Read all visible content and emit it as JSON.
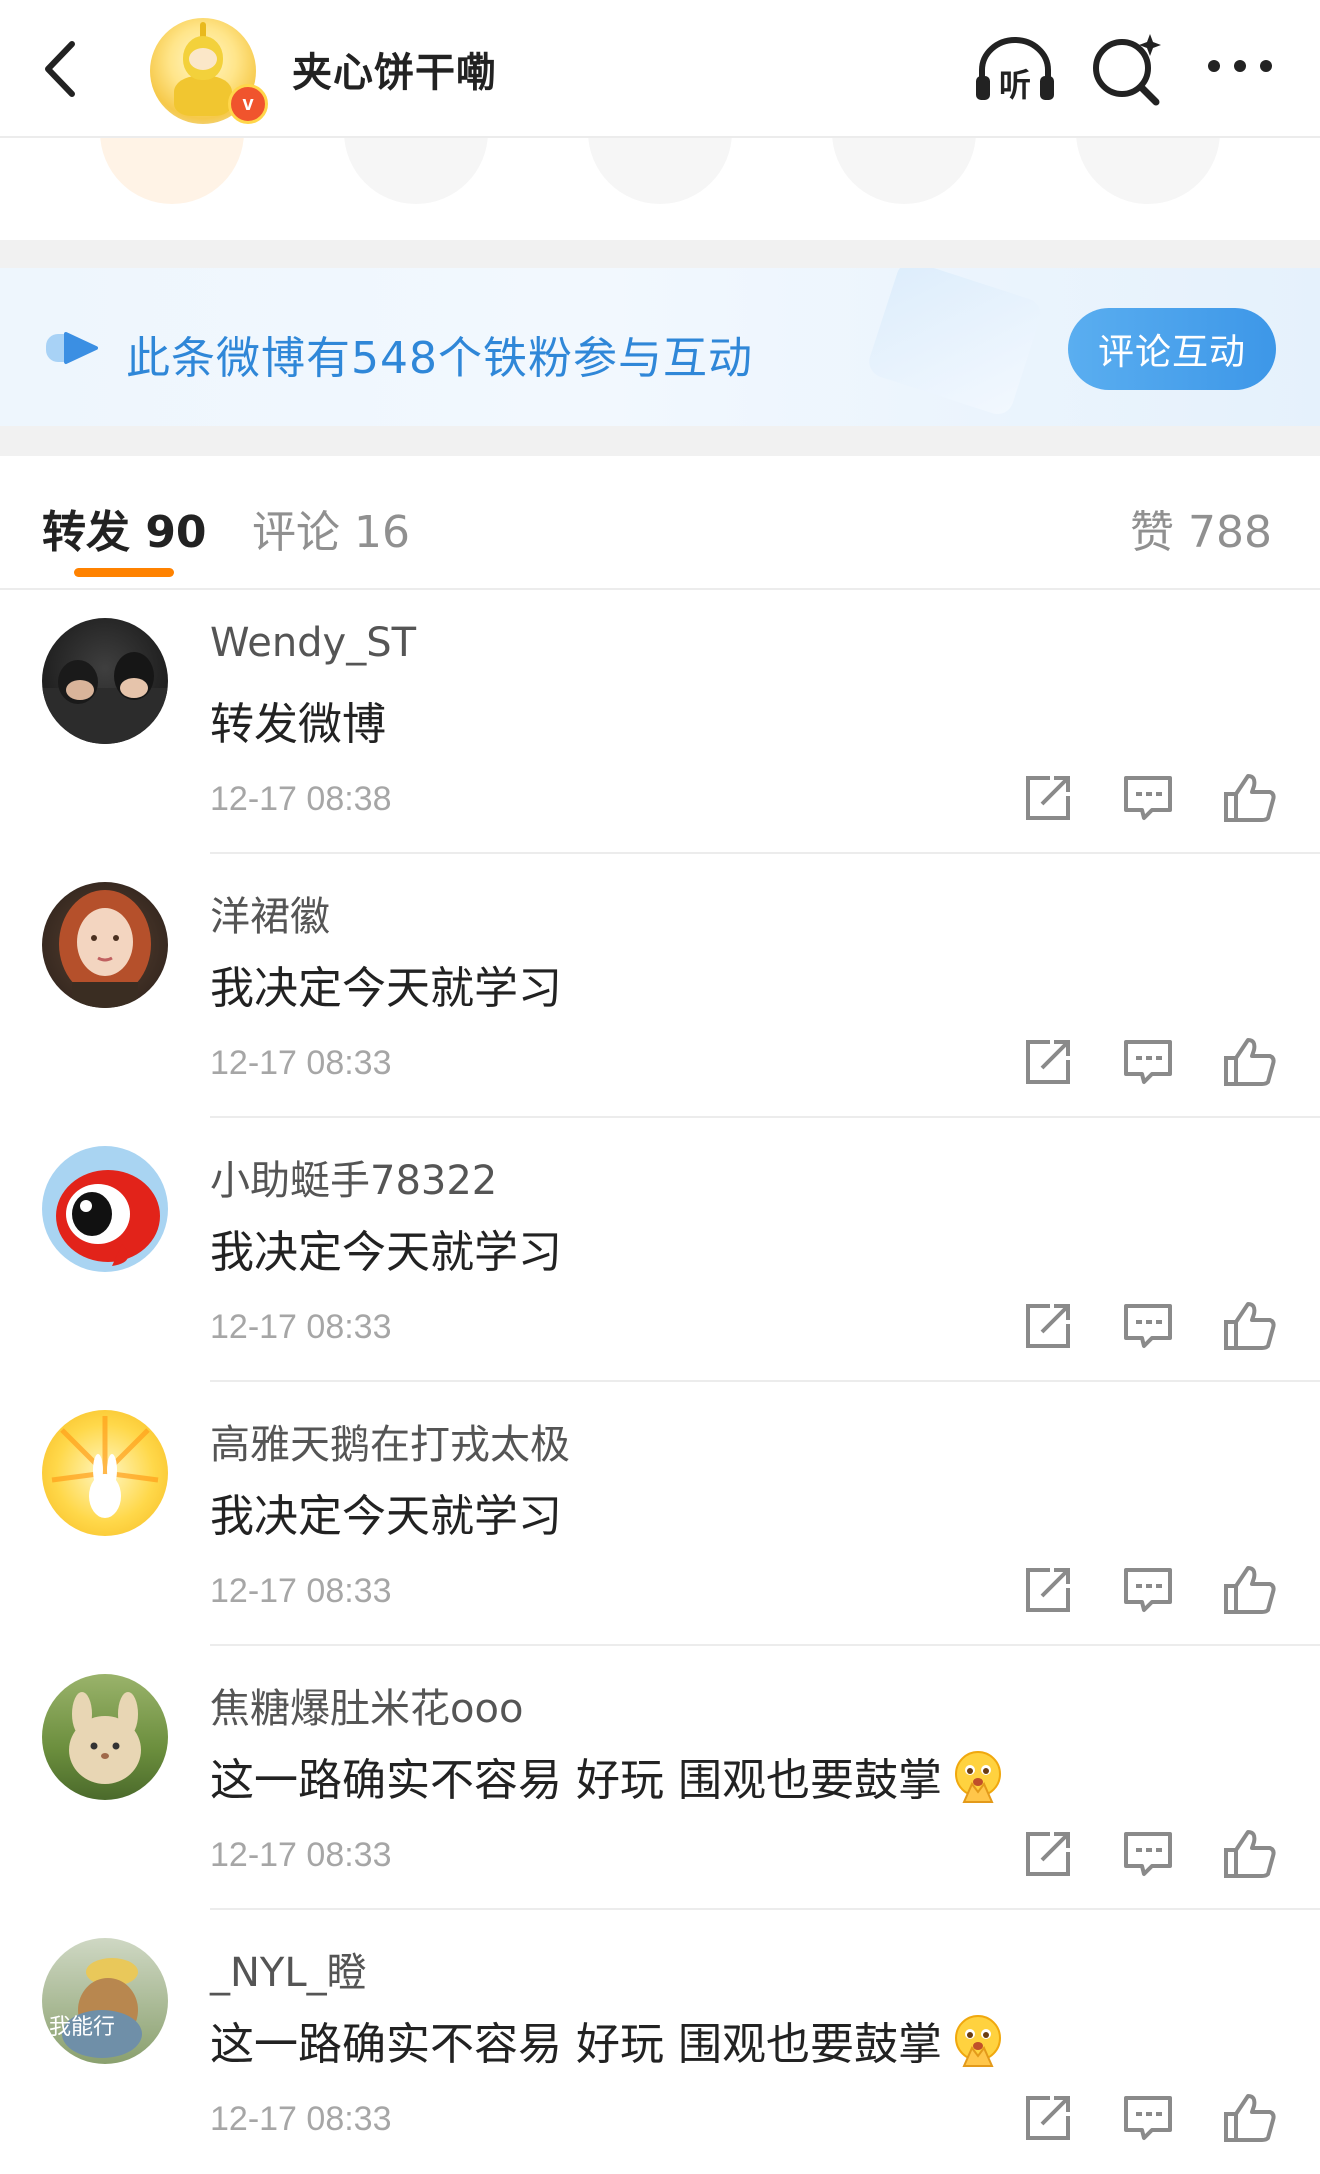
{
  "header": {
    "title": "夹心饼干嘞",
    "verified_mark": "v"
  },
  "fan_banner": {
    "text": "此条微博有548个铁粉参与互动",
    "button": "评论互动"
  },
  "tabs": {
    "repost": "转发 90",
    "comment": "评论 16",
    "like": "赞 788"
  },
  "reposts": [
    {
      "name": "Wendy_ST",
      "content": "转发微博",
      "time": "12-17 08:38"
    },
    {
      "name": "洋裙徽",
      "content": "我决定今天就学习",
      "time": "12-17 08:33"
    },
    {
      "name": "小助蜓手78322",
      "content": "我决定今天就学习",
      "time": "12-17 08:33"
    },
    {
      "name": "高雅天鹅在打戎太极",
      "content": "我决定今天就学习",
      "time": "12-17 08:33"
    },
    {
      "name": "焦糖爆肚米花ooo",
      "content": "这一路确实不容易 好玩 围观也要鼓掌",
      "time": "12-17 08:33"
    },
    {
      "name": "_NYL_瞪",
      "content": "这一路确实不容易 好玩 围观也要鼓掌",
      "time": "12-17 08:33"
    }
  ],
  "avatar_text": {
    "nyl": "我能行"
  },
  "colors": {
    "accent_orange": "#ff8200",
    "link_blue": "#2f87d8",
    "button_blue": "#3d97e8"
  },
  "icons": [
    "back-icon",
    "listen-icon",
    "ai-search-icon",
    "more-icon",
    "repost-icon",
    "comment-icon",
    "like-icon",
    "pray-emoji"
  ]
}
